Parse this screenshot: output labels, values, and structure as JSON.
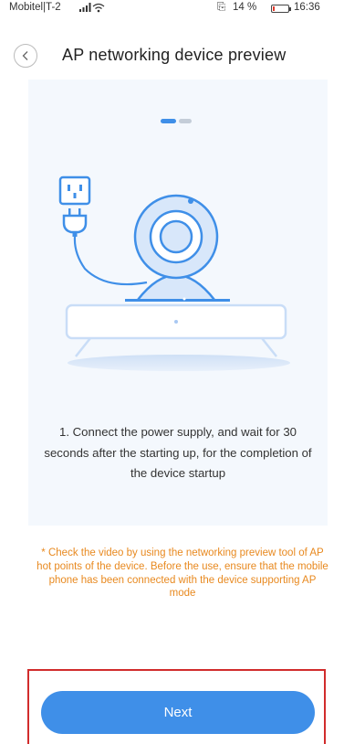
{
  "status_bar": {
    "carrier": "Mobitel|T-2",
    "battery_percent": "14 %",
    "battery_level": 0.14,
    "time": "16:36",
    "icons": [
      "signal-icon",
      "wifi-icon",
      "nfc-icon",
      "battery-icon"
    ]
  },
  "header": {
    "title": "AP networking device preview",
    "back_icon": "chevron-left-icon"
  },
  "carousel": {
    "page_count": 2,
    "active_index": 0
  },
  "step": {
    "text": "1. Connect the power supply, and wait for 30 seconds after the starting up, for the completion of the device startup"
  },
  "tip": "* Check the video by using the networking preview tool of AP hot points of the device. Before the use, ensure that the mobile phone has been connected with the device supporting AP mode",
  "next_button": {
    "label": "Next"
  },
  "colors": {
    "accent": "#3f8fe8",
    "tip": "#e8891f",
    "highlight_border": "#d12c2c",
    "card_background": "#f4f8fd"
  }
}
